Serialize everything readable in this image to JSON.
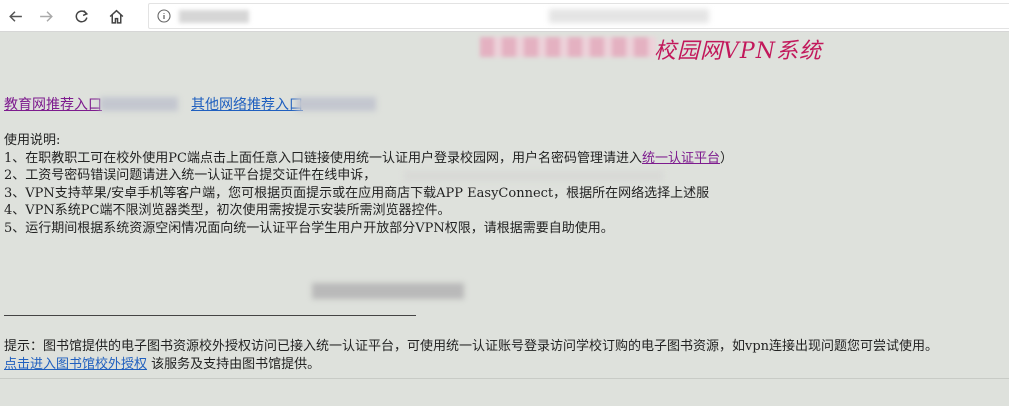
{
  "browser": {
    "back_icon": "back-arrow-icon",
    "forward_icon": "forward-arrow-icon",
    "refresh_icon": "refresh-icon",
    "home_icon": "home-icon",
    "info_icon": "info-icon"
  },
  "banner": {
    "title": "校园网VPN系统",
    "title_color": "#c2185b"
  },
  "entries": {
    "edu": "教育网推荐入口",
    "other": "其他网络推荐入口"
  },
  "usage": {
    "heading": "使用说明:",
    "line1_prefix": "1、在职教职工可在校外使用PC端点击上面任意入口链接使用统一认证用户登录校园网，用户名密码管理请进入",
    "line1_link": "统一认证平台",
    "line1_suffix": "）",
    "line2": "2、工资号密码错误问题请进入统一认证平台提交证件在线申诉，",
    "line3": "3、VPN支持苹果/安卓手机等客户端，您可根据页面提示或在应用商店下载APP EasyConnect，根据所在网络选择上述服",
    "line4": "4、VPN系统PC端不限浏览器类型，初次使用需按提示安装所需浏览器控件。",
    "line5": "5、运行期间根据系统资源空闲情况面向统一认证平台学生用户开放部分VPN权限，请根据需要自助使用。"
  },
  "notice": {
    "line1": "提示：图书馆提供的电子图书资源校外授权访问已接入统一认证平台，可使用统一认证账号登录访问学校订购的电子图书资源，如vpn连接出现问题您可尝试使用。",
    "link": "点击进入图书馆校外授权",
    "suffix": " 该服务及支持由图书馆提供。"
  },
  "colors": {
    "background": "#dee1dc",
    "visited_link": "#7d1b8e",
    "link": "#1f5fbf"
  }
}
